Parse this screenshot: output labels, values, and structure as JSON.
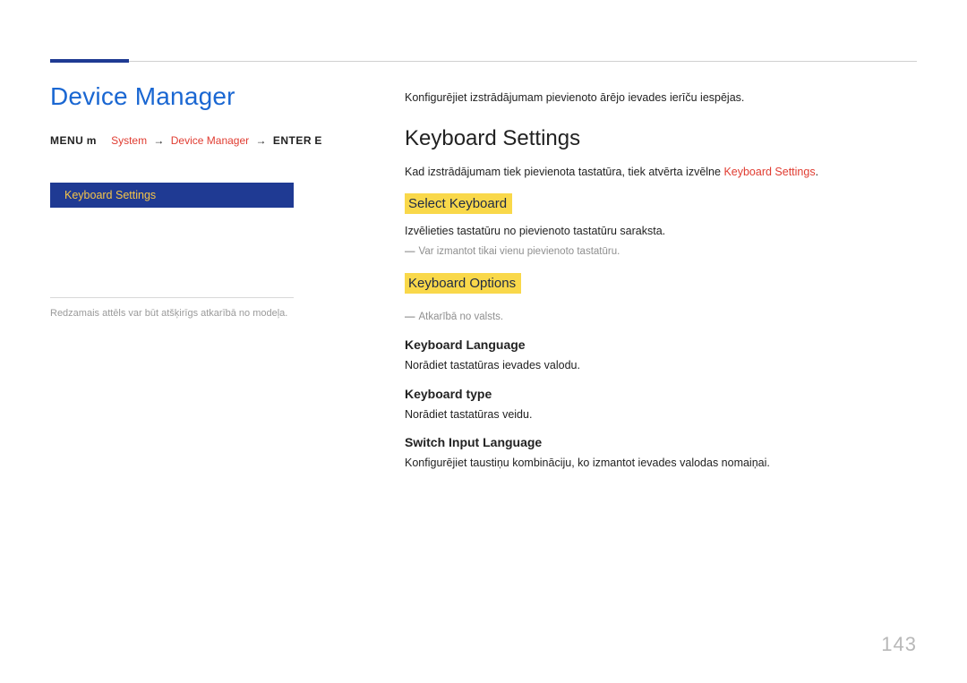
{
  "page_title": "Device Manager",
  "breadcrumb": {
    "menu": "MENU",
    "icon": "m",
    "arrow": "→",
    "part1": "System",
    "part2": "Device Manager",
    "enter": "ENTER",
    "enter_icon": "E"
  },
  "sidebar": {
    "selected_label": "Keyboard Settings"
  },
  "panel_caption": "Redzamais attēls var būt atšķirīgs atkarībā no modeļa.",
  "intro": "Konfigurējiet izstrādājumam pievienoto ārējo ievades ierīču iespējas.",
  "section": {
    "heading": "Keyboard Settings",
    "desc_pre": "Kad izstrādājumam tiek pievienota tastatūra, tiek atvērta izvēlne ",
    "desc_kw": "Keyboard Settings",
    "desc_post": "."
  },
  "select_keyboard": {
    "label": "Select Keyboard",
    "desc": "Izvēlieties tastatūru no pievienoto tastatūru saraksta.",
    "note": "Var izmantot tikai vienu pievienoto tastatūru."
  },
  "keyboard_options": {
    "label": "Keyboard Options",
    "note": "Atkarībā no valsts.",
    "items": [
      {
        "title": "Keyboard Language",
        "desc": "Norādiet tastatūras ievades valodu."
      },
      {
        "title": "Keyboard type",
        "desc": "Norādiet tastatūras veidu."
      },
      {
        "title": "Switch Input Language",
        "desc": "Konfigurējiet taustiņu kombināciju, ko izmantot ievades valodas nomaiņai."
      }
    ]
  },
  "page_number": "143",
  "dash": "―"
}
